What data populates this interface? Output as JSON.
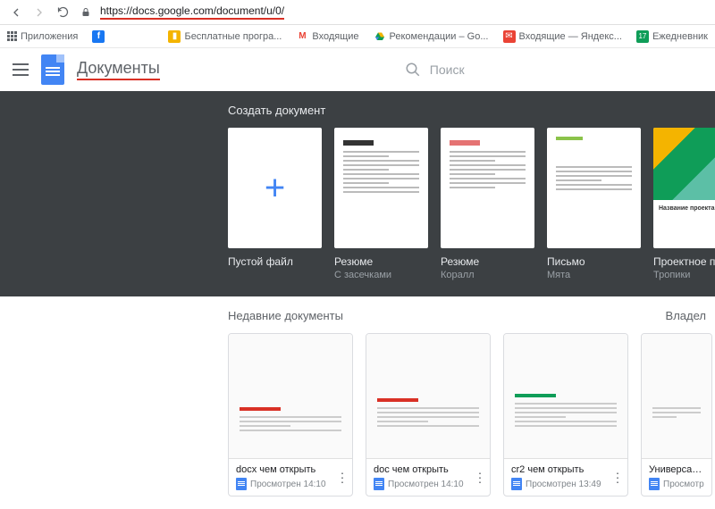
{
  "browser": {
    "url": "https://docs.google.com/document/u/0/",
    "bookmarks": [
      {
        "label": "Приложения",
        "icon": "apps"
      },
      {
        "label": "",
        "icon": "facebook"
      },
      {
        "label": "Бесплатные програ...",
        "icon": "rss",
        "color": "#f4b400"
      },
      {
        "label": "Входящие",
        "icon": "gmail"
      },
      {
        "label": "Рекомендации – Go...",
        "icon": "drive"
      },
      {
        "label": "Входящие — Яндекс...",
        "icon": "yandex",
        "color": "#ff0000"
      },
      {
        "label": "Ежедневник",
        "icon": "calendar",
        "badge": "17",
        "color": "#0f9d58"
      }
    ]
  },
  "app": {
    "title": "Документы",
    "search_placeholder": "Поиск"
  },
  "templates": {
    "heading": "Создать документ",
    "items": [
      {
        "name": "Пустой файл",
        "subtitle": "",
        "type": "blank"
      },
      {
        "name": "Резюме",
        "subtitle": "С засечками",
        "type": "resume"
      },
      {
        "name": "Резюме",
        "subtitle": "Коралл",
        "type": "resume2"
      },
      {
        "name": "Письмо",
        "subtitle": "Мята",
        "type": "letter"
      },
      {
        "name": "Проектное предло...",
        "subtitle": "Тропики",
        "type": "project",
        "thumb_title": "Название проекта"
      }
    ]
  },
  "recent": {
    "heading": "Недавние документы",
    "owner_label": "Владел",
    "items": [
      {
        "title": "docx чем открыть",
        "meta": "Просмотрен 14:10"
      },
      {
        "title": "doc чем открыть",
        "meta": "Просмотрен 14:10"
      },
      {
        "title": "cr2 чем открыть",
        "meta": "Просмотрен 13:49"
      },
      {
        "title": "Универсальнс",
        "meta": "Просмотр"
      }
    ]
  }
}
